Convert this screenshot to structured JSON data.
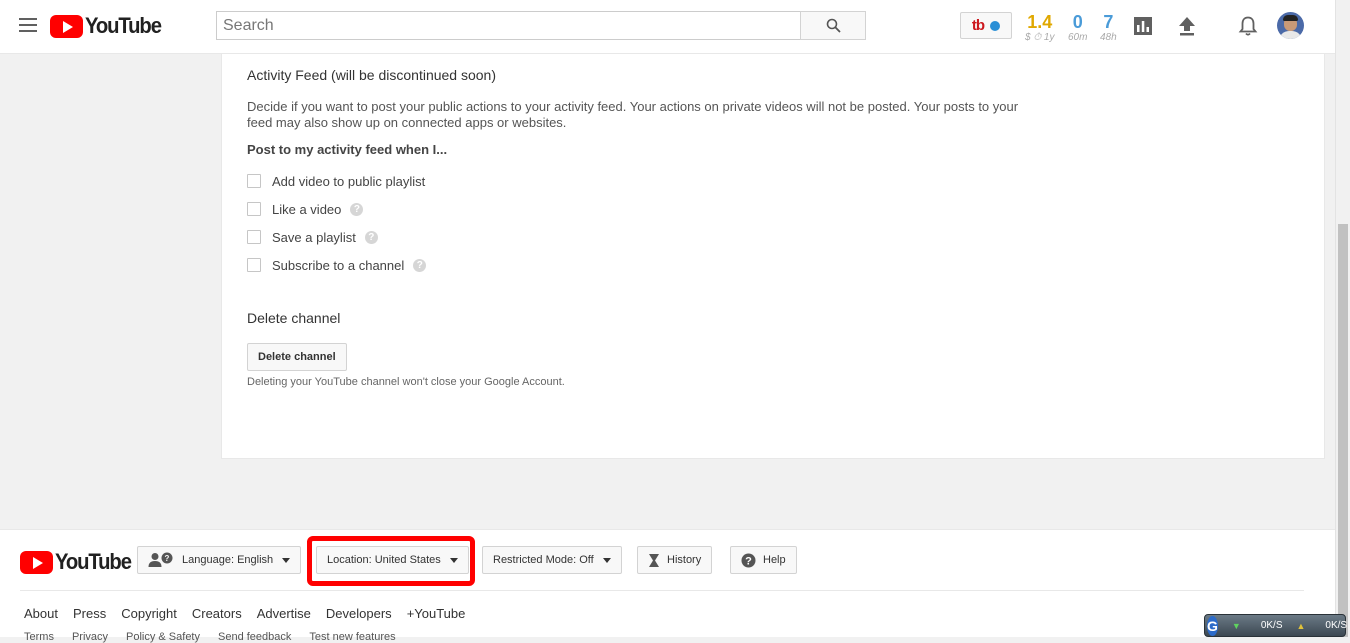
{
  "header": {
    "logo_text": "YouTube",
    "search_placeholder": "Search",
    "tb_badge": "tb",
    "stats": [
      {
        "value": "1.4",
        "sub": "$ ⏱ 1y",
        "color": "#e0a800"
      },
      {
        "value": "0",
        "sub": "60m",
        "color": "#4a9bd8"
      },
      {
        "value": "7",
        "sub": "48h",
        "color": "#4a9bd8"
      }
    ]
  },
  "activity": {
    "title": "Activity Feed (will be discontinued soon)",
    "description": "Decide if you want to post your public actions to your activity feed. Your actions on private videos will not be posted. Your posts to your feed may also show up on connected apps or websites.",
    "post_label": "Post to my activity feed when I...",
    "options": [
      {
        "label": "Add video to public playlist",
        "help": false
      },
      {
        "label": "Like a video",
        "help": true
      },
      {
        "label": "Save a playlist",
        "help": true
      },
      {
        "label": "Subscribe to a channel",
        "help": true
      }
    ],
    "help_glyph": "?"
  },
  "delete": {
    "title": "Delete channel",
    "button": "Delete channel",
    "note": "Deleting your YouTube channel won't close your Google Account."
  },
  "footer": {
    "logo_text": "YouTube",
    "language_label": "Language:",
    "language_value": "English",
    "location_label": "Location:",
    "location_value": "United States",
    "restricted_label": "Restricted Mode:",
    "restricted_value": "Off",
    "history": "History",
    "help": "Help",
    "links": [
      "About",
      "Press",
      "Copyright",
      "Creators",
      "Advertise",
      "Developers",
      "+YouTube"
    ],
    "links2": [
      "Terms",
      "Privacy",
      "Policy & Safety",
      "Send feedback",
      "Test new features"
    ],
    "highlight_color": "#ff0000"
  },
  "network_widget": {
    "down_rate": "0K/S",
    "up_rate": "0K/S"
  }
}
